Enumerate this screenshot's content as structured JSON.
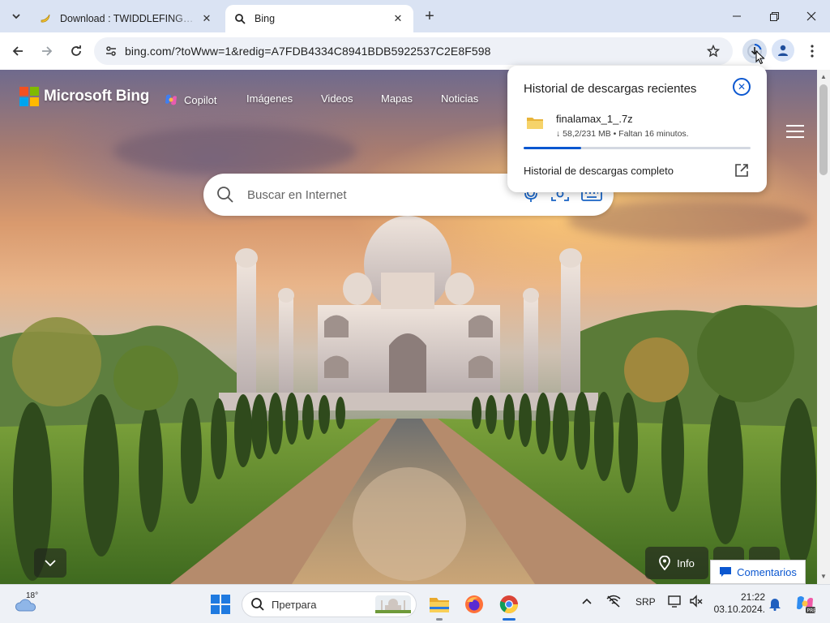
{
  "browser": {
    "tabs": [
      {
        "title": "Download : TWIDDLEFINGER (C",
        "active": false
      },
      {
        "title": "Bing",
        "active": true
      }
    ],
    "url": "bing.com/?toWww=1&redig=A7FDB4334C8941BDB5922537C2E8F598"
  },
  "bing": {
    "brand": "Microsoft Bing",
    "nav": [
      "Copilot",
      "Imágenes",
      "Videos",
      "Mapas",
      "Noticias"
    ],
    "search_placeholder": "Buscar en Internet",
    "info_label": "Info",
    "feedback_label": "Comentarios"
  },
  "downloads": {
    "heading": "Historial de descargas recientes",
    "file_name": "finalamax_1_.7z",
    "status": "↓ 58,2/231 MB • Faltan 16 minutos.",
    "progress": 0.252,
    "full_history_link": "Historial de descargas completo"
  },
  "taskbar": {
    "temperature": "18°",
    "search_label": "Претрага",
    "language": "SRP",
    "time": "21:22",
    "date": "03.10.2024."
  },
  "colors": {
    "accent": "#0b57d0",
    "ms_red": "#f25022",
    "ms_green": "#7fba00",
    "ms_blue": "#00a4ef",
    "ms_yellow": "#ffb900"
  }
}
